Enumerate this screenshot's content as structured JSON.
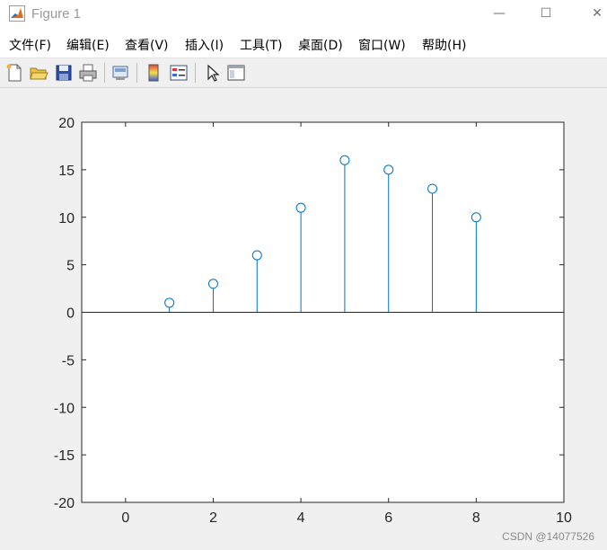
{
  "window": {
    "title": "Figure 1",
    "minimize_glyph": "—",
    "maximize_glyph": "☐",
    "close_glyph": "✕"
  },
  "menu": {
    "items": [
      "文件(F)",
      "编辑(E)",
      "查看(V)",
      "插入(I)",
      "工具(T)",
      "桌面(D)",
      "窗口(W)",
      "帮助(H)"
    ]
  },
  "toolbar": {
    "icons": [
      "new-figure-icon",
      "open-file-icon",
      "save-icon",
      "print-icon",
      "link-plot-icon",
      "colorbar-icon",
      "legend-icon",
      "pointer-icon",
      "property-editor-icon"
    ]
  },
  "chart_data": {
    "type": "stem",
    "x": [
      1,
      2,
      3,
      4,
      5,
      6,
      7,
      8
    ],
    "y": [
      1,
      3,
      6,
      11,
      16,
      15,
      13,
      10
    ],
    "xlim": [
      -1,
      10
    ],
    "ylim": [
      -20,
      20
    ],
    "xticks": [
      0,
      2,
      4,
      6,
      8,
      10
    ],
    "yticks": [
      -20,
      -15,
      -10,
      -5,
      0,
      5,
      10,
      15,
      20
    ],
    "baseline": 0,
    "marker": "o",
    "color": "#0072bd",
    "grid": false
  },
  "watermark": "CSDN @14077526"
}
